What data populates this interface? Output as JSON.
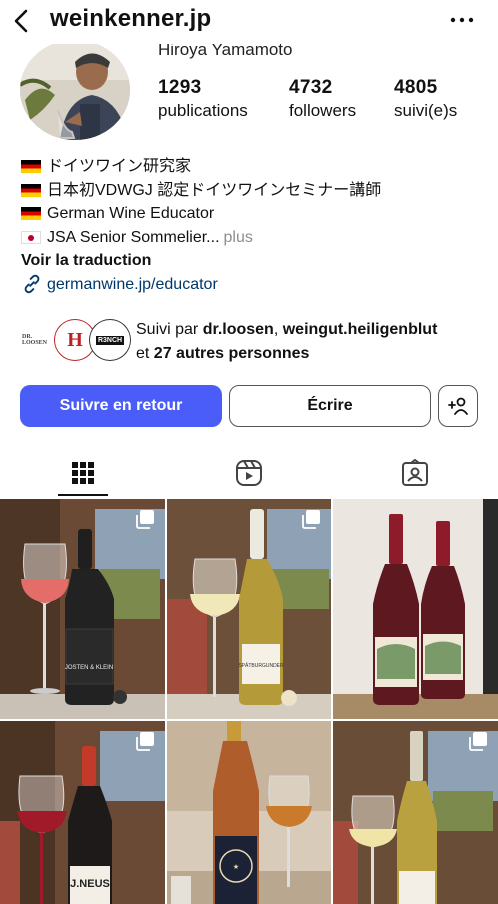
{
  "header": {
    "username": "weinkenner.jp",
    "back_icon": "chevron-left-icon",
    "more_icon": "more-horizontal-icon"
  },
  "profile": {
    "full_name": "Hiroya Yamamoto",
    "stats": [
      {
        "value": "1293",
        "label": "publications"
      },
      {
        "value": "4732",
        "label": "followers"
      },
      {
        "value": "4805",
        "label": "suivi(e)s"
      }
    ],
    "bio": {
      "line1": "ドイツワイン研究家",
      "line2": "日本初VDWGJ 認定ドイツワインセミナー講師",
      "line3": "German Wine Educator",
      "line4": "JSA Senior Sommelier...",
      "more_label": "plus",
      "translate_label": "Voir la traduction",
      "link": "germanwine.jp/educator"
    },
    "followed_by": {
      "prefix": "Suivi par",
      "user1": "dr.loosen",
      "separator": ",",
      "user2": "weingut.heiligenblut",
      "conj": "et",
      "others": "27 autres personnes",
      "icon_labels": [
        "DR. LOOSEN",
        "H",
        "R3NCH"
      ]
    }
  },
  "actions": {
    "follow_back": "Suivre en retour",
    "message": "Écrire",
    "add_user_icon": "add-person-icon"
  },
  "tabs": [
    {
      "name": "grid",
      "icon": "grid-icon"
    },
    {
      "name": "reels",
      "icon": "reels-icon"
    },
    {
      "name": "tagged",
      "icon": "tagged-icon"
    }
  ],
  "posts": {
    "bottle_labels": [
      "JOSTEN & KLEIN",
      "SPÄTBURGUNDER",
      "",
      "J.NEUS",
      "",
      ""
    ]
  },
  "colors": {
    "follow_button": "#4a5df9",
    "link": "#00376b",
    "muted": "#8e8e8e"
  }
}
